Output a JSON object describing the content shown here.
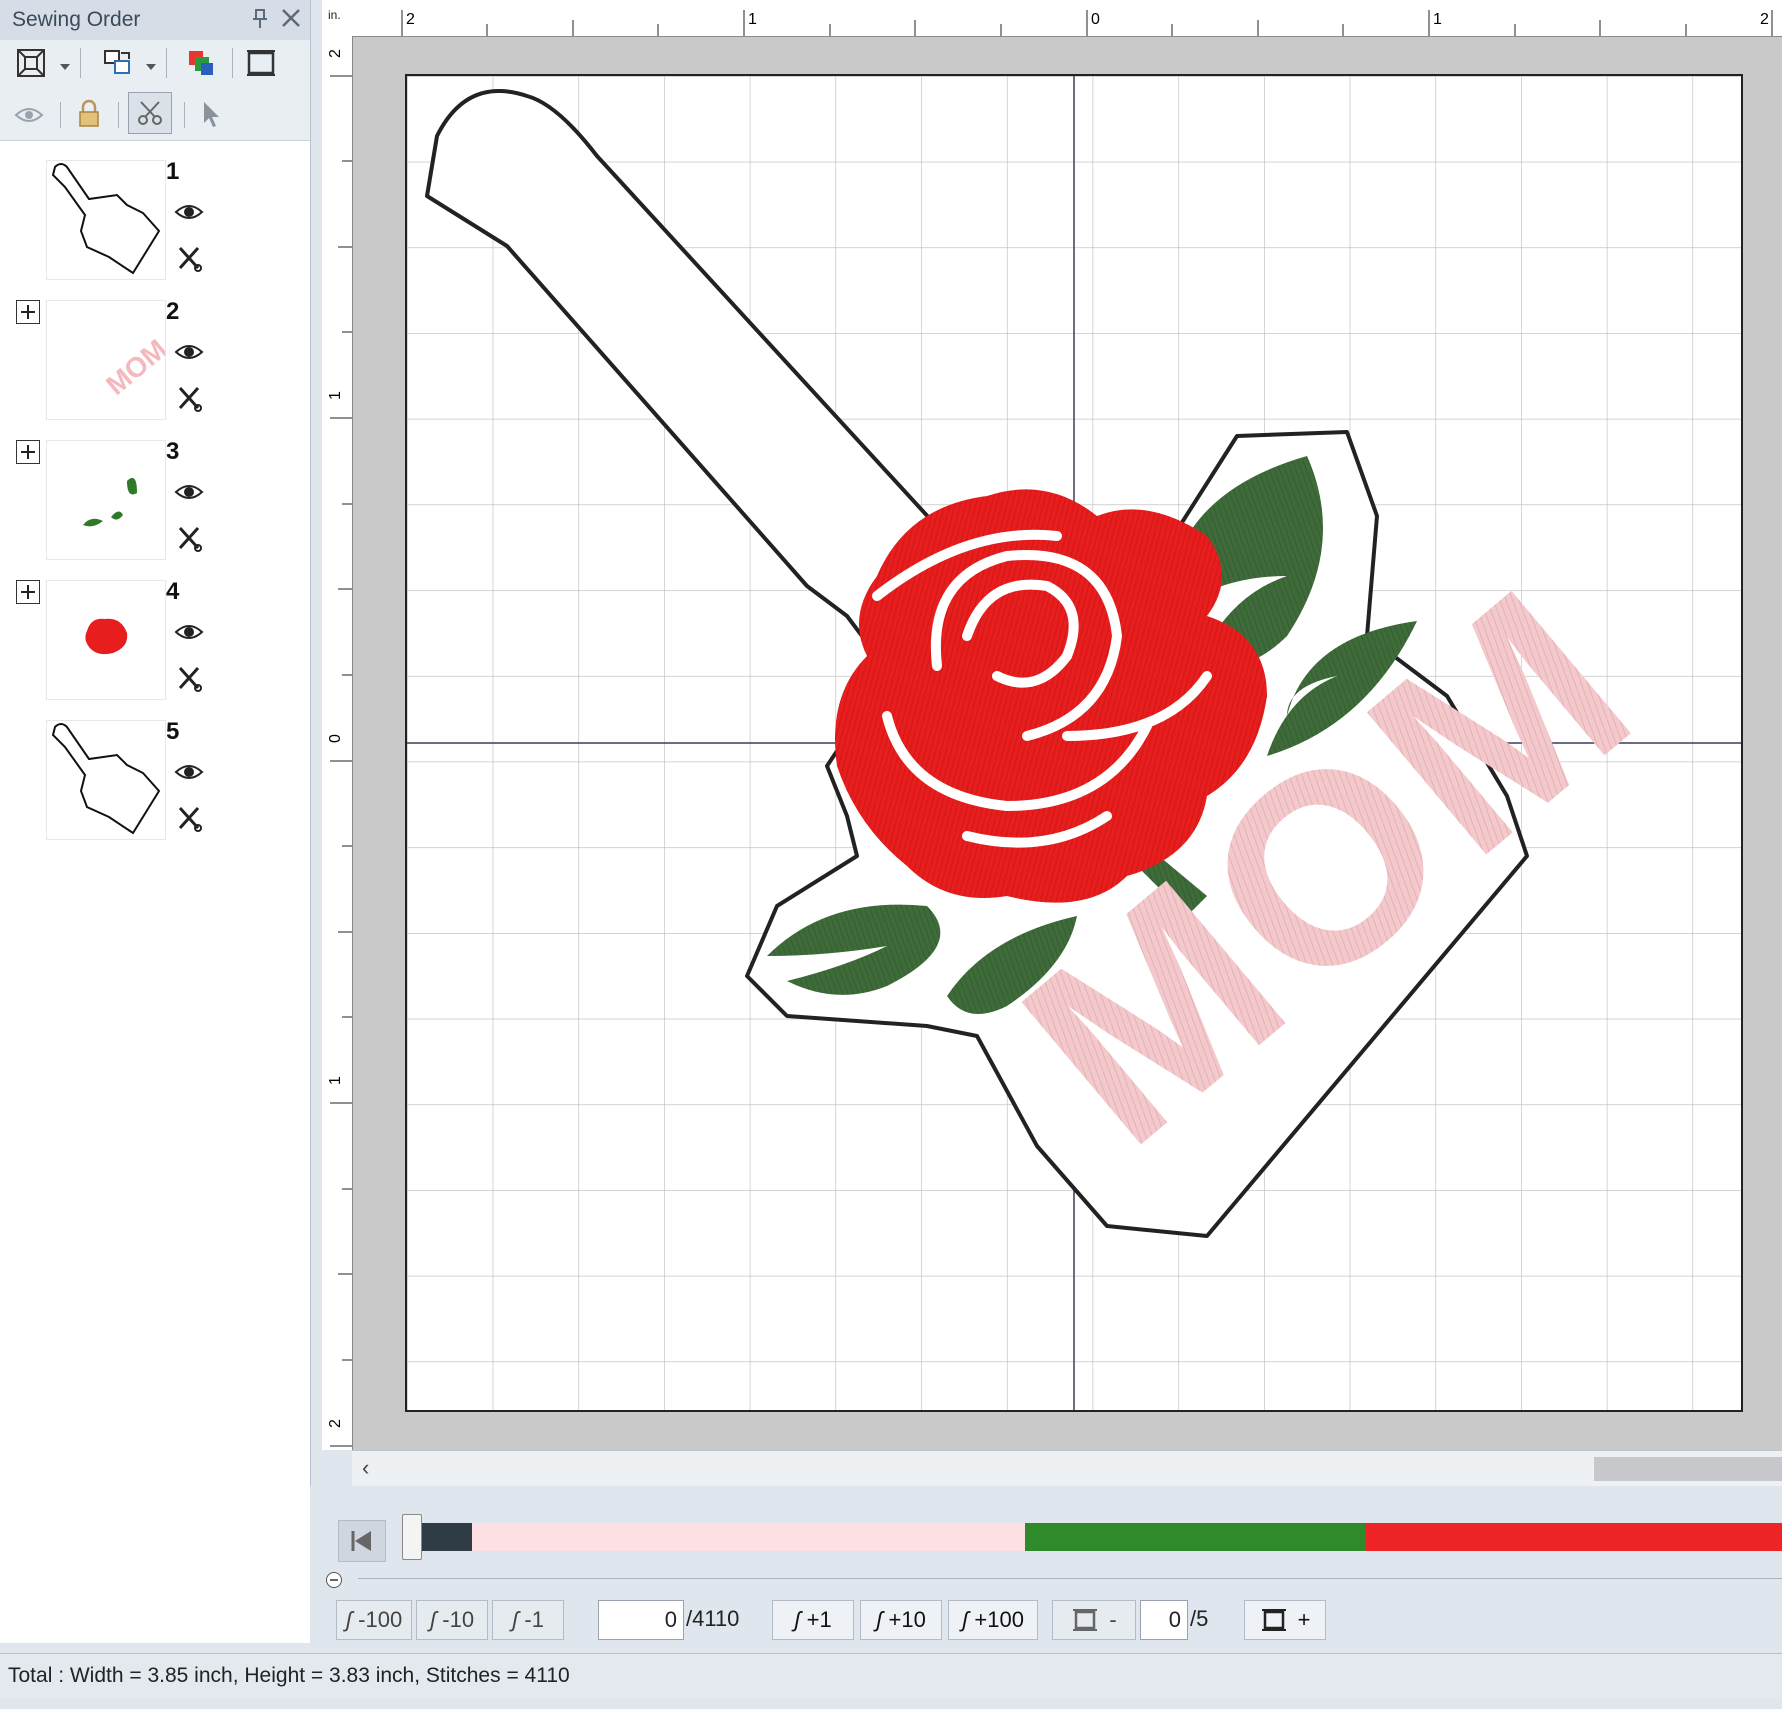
{
  "panel": {
    "title": "Sewing Order",
    "items": [
      {
        "number": "1",
        "content": "Outline"
      },
      {
        "number": "2",
        "content": "MOM"
      },
      {
        "number": "3",
        "content": "Leaves"
      },
      {
        "number": "4",
        "content": "Rose"
      },
      {
        "number": "5",
        "content": "Outline"
      }
    ]
  },
  "canvas": {
    "ruler_unit": "in.",
    "top_ruler_labels": [
      "2",
      "1",
      "0",
      "1",
      "2"
    ],
    "left_ruler_labels": [
      "2",
      "1",
      "0",
      "1",
      "2"
    ],
    "design_text": "MOM",
    "colors": {
      "outline": "#222222",
      "pink": "#f4c9cc",
      "leaf": "#3f6b3a",
      "rose": "#e81e1e"
    }
  },
  "stitch_bar": {
    "segments": [
      {
        "color": "#2f3c46",
        "fraction": 0.045
      },
      {
        "color": "#fce0e3",
        "fraction": 0.403
      },
      {
        "color": "#2f8a2b",
        "fraction": 0.248
      },
      {
        "color": "#ee2427",
        "fraction": 0.304
      }
    ]
  },
  "controls": {
    "minus100": "-100",
    "minus10": "-10",
    "minus1": "-1",
    "current_stitch": "0",
    "total_stitches": "/4110",
    "plus1": "+1",
    "plus10": "+10",
    "plus100": "+100",
    "frame_minus": "-",
    "current_color": "0",
    "total_colors": "/5",
    "frame_plus": "+"
  },
  "status": "Total : Width = 3.85 inch, Height = 3.83 inch, Stitches = 4110"
}
